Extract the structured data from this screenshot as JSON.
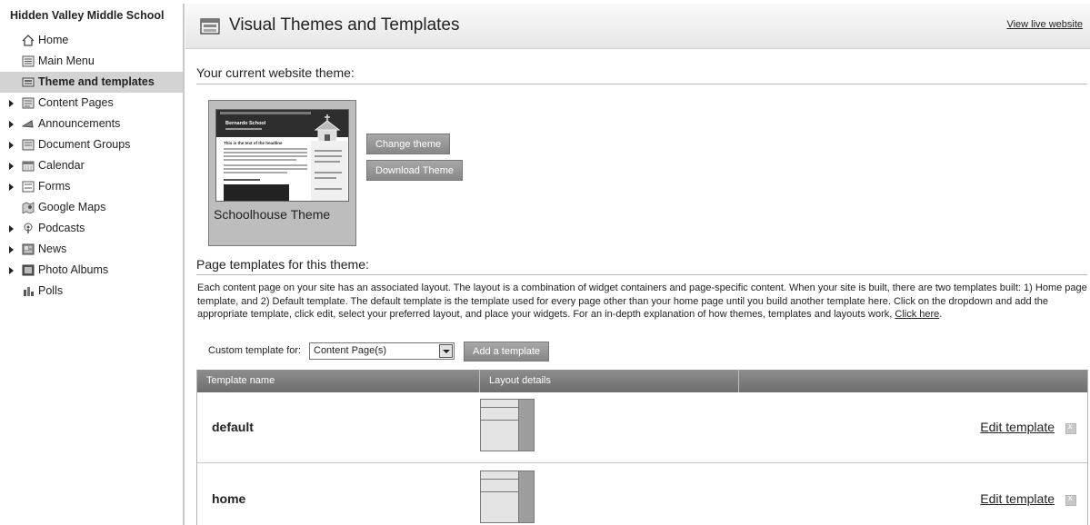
{
  "sidebar": {
    "school_name": "Hidden Valley Middle School",
    "items": [
      {
        "label": "Home",
        "icon": "home-icon",
        "expandable": false,
        "active": false
      },
      {
        "label": "Main Menu",
        "icon": "menu-icon",
        "expandable": false,
        "active": false
      },
      {
        "label": "Theme and templates",
        "icon": "theme-icon",
        "expandable": false,
        "active": true
      },
      {
        "label": "Content Pages",
        "icon": "page-icon",
        "expandable": true,
        "active": false
      },
      {
        "label": "Announcements",
        "icon": "megaphone-icon",
        "expandable": true,
        "active": false
      },
      {
        "label": "Document Groups",
        "icon": "document-icon",
        "expandable": true,
        "active": false
      },
      {
        "label": "Calendar",
        "icon": "calendar-icon",
        "expandable": true,
        "active": false
      },
      {
        "label": "Forms",
        "icon": "form-icon",
        "expandable": true,
        "active": false
      },
      {
        "label": "Google Maps",
        "icon": "map-icon",
        "expandable": false,
        "active": false
      },
      {
        "label": "Podcasts",
        "icon": "podcast-icon",
        "expandable": true,
        "active": false
      },
      {
        "label": "News",
        "icon": "news-icon",
        "expandable": true,
        "active": false
      },
      {
        "label": "Photo Albums",
        "icon": "photo-icon",
        "expandable": true,
        "active": false
      },
      {
        "label": "Polls",
        "icon": "poll-icon",
        "expandable": false,
        "active": false
      }
    ]
  },
  "header": {
    "title": "Visual Themes and Templates",
    "view_live": "View live website"
  },
  "current_theme": {
    "heading": "Your current website theme:",
    "name": "Schoolhouse Theme",
    "thumb_title": "Bernardo School",
    "thumb_subtitle": "This is the text of the headline",
    "change_button": "Change theme",
    "download_button": "Download Theme"
  },
  "templates": {
    "heading": "Page templates for this theme:",
    "description": "Each content page on your site has an associated layout. The layout is a combination of widget containers and page-specific content. When your site is built, there are two templates built: 1) Home page template, and 2) Default template. The default template is the template used for every page other than your home page until you build another template here. Click on the dropdown and add the appropriate template, click edit, select your preferred layout, and place your widgets. For an in-depth explanation of how themes, templates and layouts work,",
    "click_here": "Click here",
    "custom_label": "Custom template for:",
    "select_value": "Content Page(s)",
    "add_button": "Add a template",
    "columns": [
      "Template name",
      "Layout details",
      ""
    ],
    "rows": [
      {
        "name": "default",
        "edit_label": "Edit template"
      },
      {
        "name": "home",
        "edit_label": "Edit template"
      }
    ]
  },
  "colors": {
    "active_bg": "#d3d3d3",
    "button_bg": "#8f8f8f",
    "table_header_bg": "#7d7d7d"
  }
}
